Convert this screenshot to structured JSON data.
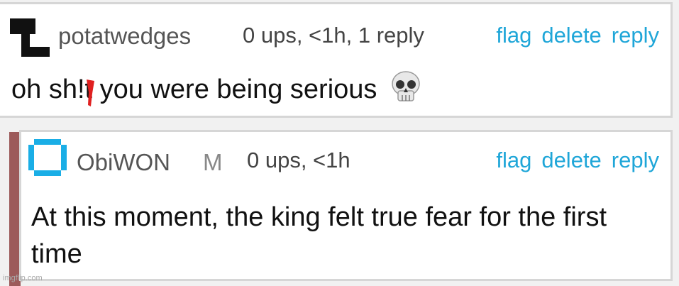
{
  "comments": [
    {
      "username": "potatwedges",
      "meta": "0 ups, <1h, 1 reply",
      "actions": [
        "flag",
        "delete",
        "reply"
      ],
      "text": "oh sh!t you were being serious",
      "emoji": "skull"
    },
    {
      "username": "ObiWON",
      "badge": "M",
      "meta": "0 ups, <1h",
      "actions": [
        "flag",
        "delete",
        "reply"
      ],
      "text": "At this moment, the king felt true fear for the first time"
    }
  ],
  "watermark": "imgflip.com",
  "colors": {
    "action_link": "#1fa6d8",
    "reply_bar": "#9c5a5a",
    "censor_mark": "#e02020"
  }
}
